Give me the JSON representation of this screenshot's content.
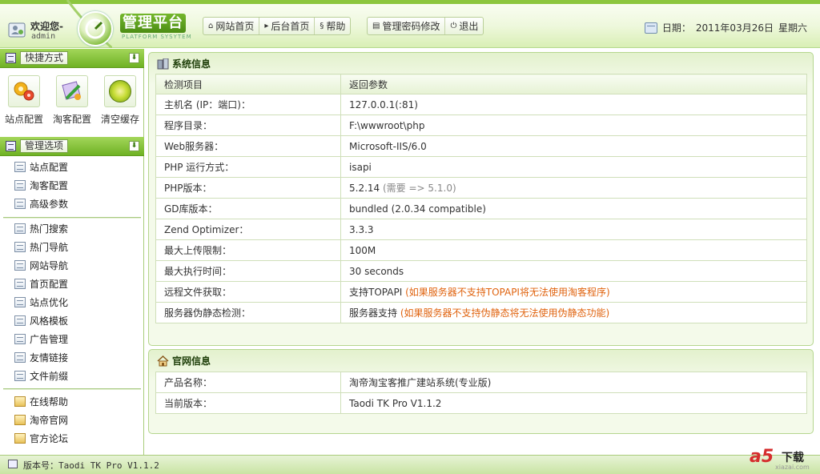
{
  "header": {
    "welcome": "欢迎您-",
    "username": "admin",
    "logo_title": "管理平台",
    "logo_sub": "PLATFORM SYSYTEM",
    "nav_group1": [
      {
        "label": "网站首页",
        "icon": "home-icon"
      },
      {
        "label": "后台首页",
        "icon": "play-icon"
      },
      {
        "label": "帮助",
        "icon": "help-icon"
      }
    ],
    "nav_group2": [
      {
        "label": "管理密码修改",
        "icon": "list-icon"
      },
      {
        "label": "退出",
        "icon": "power-icon"
      }
    ],
    "date_label": "日期：",
    "date_value": "2011年03月26日",
    "weekday": "星期六"
  },
  "sidebar": {
    "shortcut_title": "快捷方式",
    "shortcuts": [
      {
        "label": "站点配置",
        "icon": "gears-icon"
      },
      {
        "label": "淘客配置",
        "icon": "tools-icon"
      },
      {
        "label": "清空缓存",
        "icon": "radiation-icon"
      }
    ],
    "manage_title": "管理选项",
    "group1": [
      "站点配置",
      "淘客配置",
      "高级参数"
    ],
    "group2": [
      "热门搜索",
      "热门导航",
      "网站导航",
      "首页配置",
      "站点优化",
      "风格模板",
      "广告管理",
      "友情链接",
      "文件前缀"
    ],
    "group3": [
      "在线帮助",
      "淘帝官网",
      "官方论坛"
    ]
  },
  "system_info": {
    "title": "系统信息",
    "headers": [
      "检测项目",
      "返回参数"
    ],
    "rows": [
      {
        "key": "主机名 (IP：端口)：",
        "value": "127.0.0.1(:81)",
        "extra": ""
      },
      {
        "key": "程序目录：",
        "value": "F:\\wwwroot\\php",
        "extra": ""
      },
      {
        "key": "Web服务器：",
        "value": "Microsoft-IIS/6.0",
        "extra": ""
      },
      {
        "key": "PHP 运行方式：",
        "value": "isapi",
        "extra": ""
      },
      {
        "key": "PHP版本：",
        "value": "5.2.14",
        "extra": "(需要 => 5.1.0)"
      },
      {
        "key": "GD库版本：",
        "value": "bundled (2.0.34 compatible)",
        "extra": ""
      },
      {
        "key": "Zend Optimizer：",
        "value": "3.3.3",
        "extra": ""
      },
      {
        "key": "最大上传限制：",
        "value": "100M",
        "extra": ""
      },
      {
        "key": "最大执行时间：",
        "value": "30 seconds",
        "extra": ""
      },
      {
        "key": "远程文件获取：",
        "value": "支持TOPAPI",
        "note": "(如果服务器不支持TOPAPI将无法使用淘客程序)"
      },
      {
        "key": "服务器伪静态检测：",
        "value": "服务器支持",
        "note": "(如果服务器不支持伪静态将无法使用伪静态功能)"
      }
    ]
  },
  "official_info": {
    "title": "官网信息",
    "rows": [
      {
        "key": "产品名称：",
        "value": "淘帝淘宝客推广建站系统(专业版)"
      },
      {
        "key": "当前版本：",
        "value": "Taodi TK Pro V1.1.2"
      }
    ]
  },
  "footer": {
    "version": "版本号：Taodi TK Pro V1.1.2",
    "watermark_logo": "a5",
    "watermark_text": "下载",
    "watermark_site": "xiazai.com"
  }
}
